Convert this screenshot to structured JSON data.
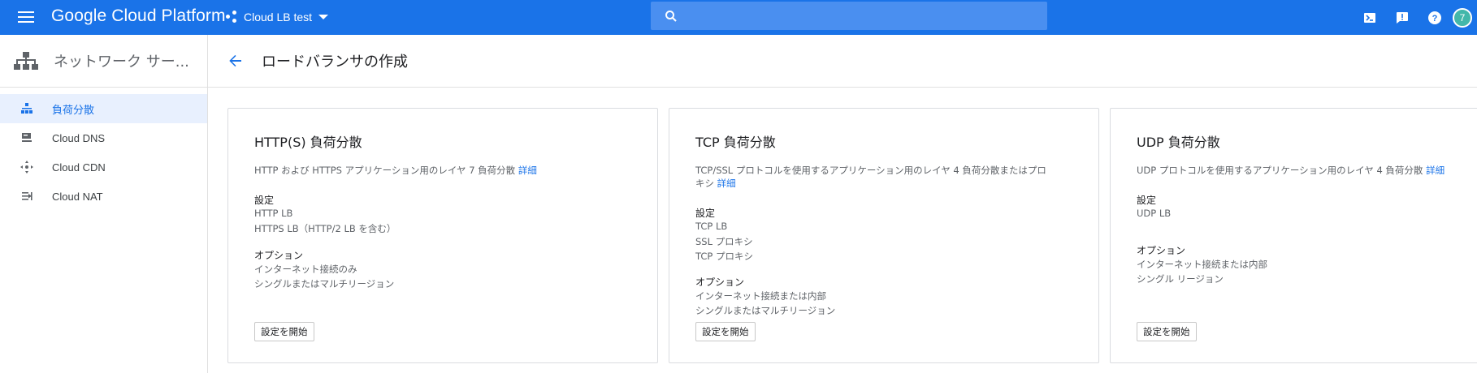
{
  "topbar": {
    "brand": "Google Cloud Platform",
    "project": "Cloud LB test",
    "search_placeholder": "",
    "avatar_letter": "7",
    "colors": {
      "bar": "#1a73e8",
      "avatar": "#42b7aa"
    }
  },
  "sidebar": {
    "title": "ネットワーク サー...",
    "items": [
      {
        "label": "負荷分散",
        "icon": "load-balancing-icon",
        "active": true
      },
      {
        "label": "Cloud DNS",
        "icon": "dns-icon",
        "active": false
      },
      {
        "label": "Cloud CDN",
        "icon": "cdn-icon",
        "active": false
      },
      {
        "label": "Cloud NAT",
        "icon": "nat-icon",
        "active": false
      }
    ]
  },
  "header": {
    "title": "ロードバランサの作成"
  },
  "cards": [
    {
      "title": "HTTP(S) 負荷分散",
      "desc": "HTTP および HTTPS アプリケーション用のレイヤ 7 負荷分散",
      "link": "詳細",
      "config_heading": "設定",
      "config": [
        "HTTP LB",
        "HTTPS LB（HTTP/2 LB を含む）"
      ],
      "options_heading": "オプション",
      "options": [
        "インターネット接続のみ",
        "シングルまたはマルチリージョン"
      ],
      "button": "設定を開始"
    },
    {
      "title": "TCP 負荷分散",
      "desc_line1": "TCP/SSL プロトコルを使用するアプリケーション用のレイヤ 4 負荷分散またはプロ",
      "desc_line2": "キシ",
      "link": "詳細",
      "config_heading": "設定",
      "config": [
        "TCP LB",
        "SSL プロキシ",
        "TCP プロキシ"
      ],
      "options_heading": "オプション",
      "options": [
        "インターネット接続または内部",
        "シングルまたはマルチリージョン"
      ],
      "button": "設定を開始"
    },
    {
      "title": "UDP 負荷分散",
      "desc": "UDP プロトコルを使用するアプリケーション用のレイヤ 4 負荷分散",
      "link": "詳細",
      "config_heading": "設定",
      "config": [
        "UDP LB"
      ],
      "options_heading": "オプション",
      "options": [
        "インターネット接続または内部",
        "シングル リージョン"
      ],
      "button": "設定を開始"
    }
  ]
}
